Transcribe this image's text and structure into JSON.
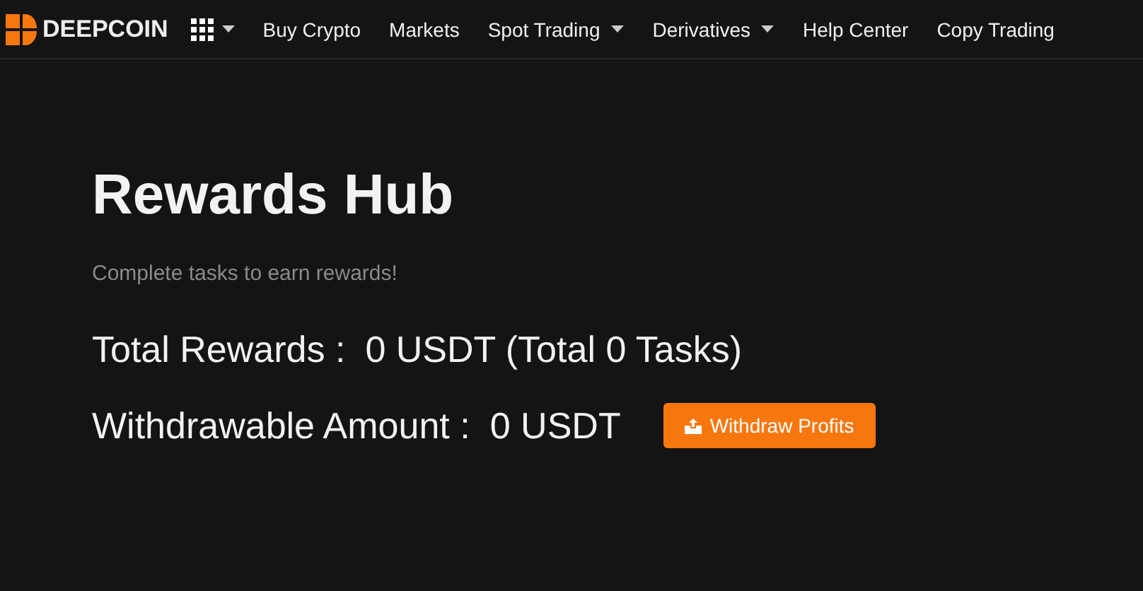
{
  "nav": {
    "logo": "DEEPCOIN",
    "items": [
      {
        "label": "Buy Crypto",
        "has_menu": false
      },
      {
        "label": "Markets",
        "has_menu": false
      },
      {
        "label": "Spot Trading",
        "has_menu": true
      },
      {
        "label": "Derivatives",
        "has_menu": true
      },
      {
        "label": "Help Center",
        "has_menu": false
      },
      {
        "label": "Copy Trading",
        "has_menu": false
      }
    ]
  },
  "title": "Rewards Hub",
  "subtitle": "Complete tasks to earn rewards!",
  "total": {
    "label": "Total Rewards :",
    "value": "0 USDT (Total 0 Tasks)"
  },
  "withdrawable": {
    "label": "Withdrawable Amount :",
    "value": "0 USDT"
  },
  "withdraw_button": "Withdraw Profits"
}
